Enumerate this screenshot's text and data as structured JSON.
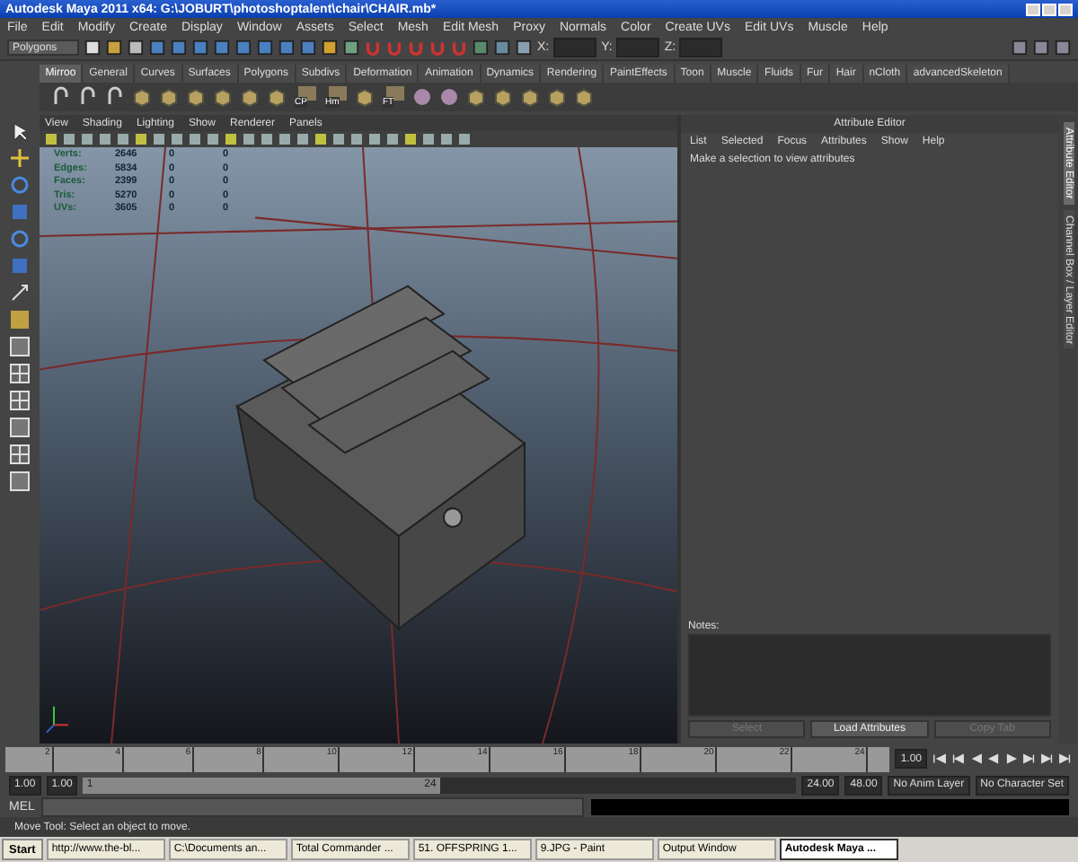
{
  "window": {
    "title": "Autodesk Maya 2011 x64: G:\\JOBURT\\photoshoptalent\\chair\\CHAIR.mb*"
  },
  "menus": [
    "File",
    "Edit",
    "Modify",
    "Create",
    "Display",
    "Window",
    "Assets",
    "Select",
    "Mesh",
    "Edit Mesh",
    "Proxy",
    "Normals",
    "Color",
    "Create UVs",
    "Edit UVs",
    "Muscle",
    "Help"
  ],
  "status_line": {
    "mode": "Polygons",
    "coord_labels": [
      "X:",
      "Y:",
      "Z:"
    ]
  },
  "shelf": {
    "tabs": [
      {
        "label": "Mirroo",
        "selected": true
      },
      {
        "label": "General",
        "selected": false
      },
      {
        "label": "Curves",
        "selected": false
      },
      {
        "label": "Surfaces",
        "selected": false
      },
      {
        "label": "Polygons",
        "selected": false
      },
      {
        "label": "Subdivs",
        "selected": false
      },
      {
        "label": "Deformation",
        "selected": false
      },
      {
        "label": "Animation",
        "selected": false
      },
      {
        "label": "Dynamics",
        "selected": false
      },
      {
        "label": "Rendering",
        "selected": false
      },
      {
        "label": "PaintEffects",
        "selected": false
      },
      {
        "label": "Toon",
        "selected": false
      },
      {
        "label": "Muscle",
        "selected": false
      },
      {
        "label": "Fluids",
        "selected": false
      },
      {
        "label": "Fur",
        "selected": false
      },
      {
        "label": "Hair",
        "selected": false
      },
      {
        "label": "nCloth",
        "selected": false
      },
      {
        "label": "advancedSkeleton",
        "selected": false
      }
    ],
    "icons": [
      {
        "kind": "hook"
      },
      {
        "kind": "hook"
      },
      {
        "kind": "hook"
      },
      {
        "kind": "cube"
      },
      {
        "kind": "cube"
      },
      {
        "kind": "cube"
      },
      {
        "kind": "cube"
      },
      {
        "kind": "cube"
      },
      {
        "kind": "cube"
      },
      {
        "kind": "labeled",
        "label": "CP"
      },
      {
        "kind": "labeled",
        "label": "Hm"
      },
      {
        "kind": "cube"
      },
      {
        "kind": "labeled",
        "label": "FT"
      },
      {
        "kind": "sphere"
      },
      {
        "kind": "sphere"
      },
      {
        "kind": "cube"
      },
      {
        "kind": "cube"
      },
      {
        "kind": "cube"
      },
      {
        "kind": "cube"
      },
      {
        "kind": "cube"
      }
    ]
  },
  "viewport": {
    "menus": [
      "View",
      "Shading",
      "Lighting",
      "Show",
      "Renderer",
      "Panels"
    ],
    "stats": [
      {
        "label": "Verts:",
        "values": [
          "2646",
          "0",
          "0"
        ]
      },
      {
        "label": "Edges:",
        "values": [
          "5834",
          "0",
          "0"
        ]
      },
      {
        "label": "Faces:",
        "values": [
          "2399",
          "0",
          "0"
        ]
      },
      {
        "label": "Tris:",
        "values": [
          "5270",
          "0",
          "0"
        ]
      },
      {
        "label": "UVs:",
        "values": [
          "3605",
          "0",
          "0"
        ]
      }
    ]
  },
  "attribute_editor": {
    "title": "Attribute Editor",
    "menus": [
      "List",
      "Selected",
      "Focus",
      "Attributes",
      "Show",
      "Help"
    ],
    "message": "Make a selection to view attributes",
    "notes_label": "Notes:",
    "buttons": [
      {
        "label": "Select",
        "disabled": true
      },
      {
        "label": "Load Attributes",
        "disabled": false
      },
      {
        "label": "Copy Tab",
        "disabled": true
      }
    ]
  },
  "side_tabs": [
    {
      "label": "Attribute Editor",
      "selected": true
    },
    {
      "label": "Channel Box / Layer Editor",
      "selected": false
    }
  ],
  "timeline": {
    "ticks": [
      "2",
      "4",
      "6",
      "8",
      "10",
      "12",
      "14",
      "16",
      "18",
      "20",
      "22",
      "24"
    ],
    "current_frame": "1.00"
  },
  "range": {
    "start": "1.00",
    "playback_start": "1.00",
    "handle_start": "1",
    "handle_end": "24",
    "level": 0.5,
    "playback_end": "24.00",
    "end": "48.00",
    "anim_layer": "No Anim Layer",
    "character_set": "No Character Set"
  },
  "command_line": {
    "label": "MEL"
  },
  "help_line": "Move Tool: Select an object to move.",
  "taskbar": {
    "start": "Start",
    "items": [
      {
        "label": "http://www.the-bl...",
        "selected": false
      },
      {
        "label": "C:\\Documents an...",
        "selected": false
      },
      {
        "label": "Total Commander ...",
        "selected": false
      },
      {
        "label": "51. OFFSPRING 1...",
        "selected": false
      },
      {
        "label": "9.JPG - Paint",
        "selected": false
      },
      {
        "label": "Output Window",
        "selected": false
      },
      {
        "label": "Autodesk Maya ...",
        "selected": true
      }
    ]
  }
}
